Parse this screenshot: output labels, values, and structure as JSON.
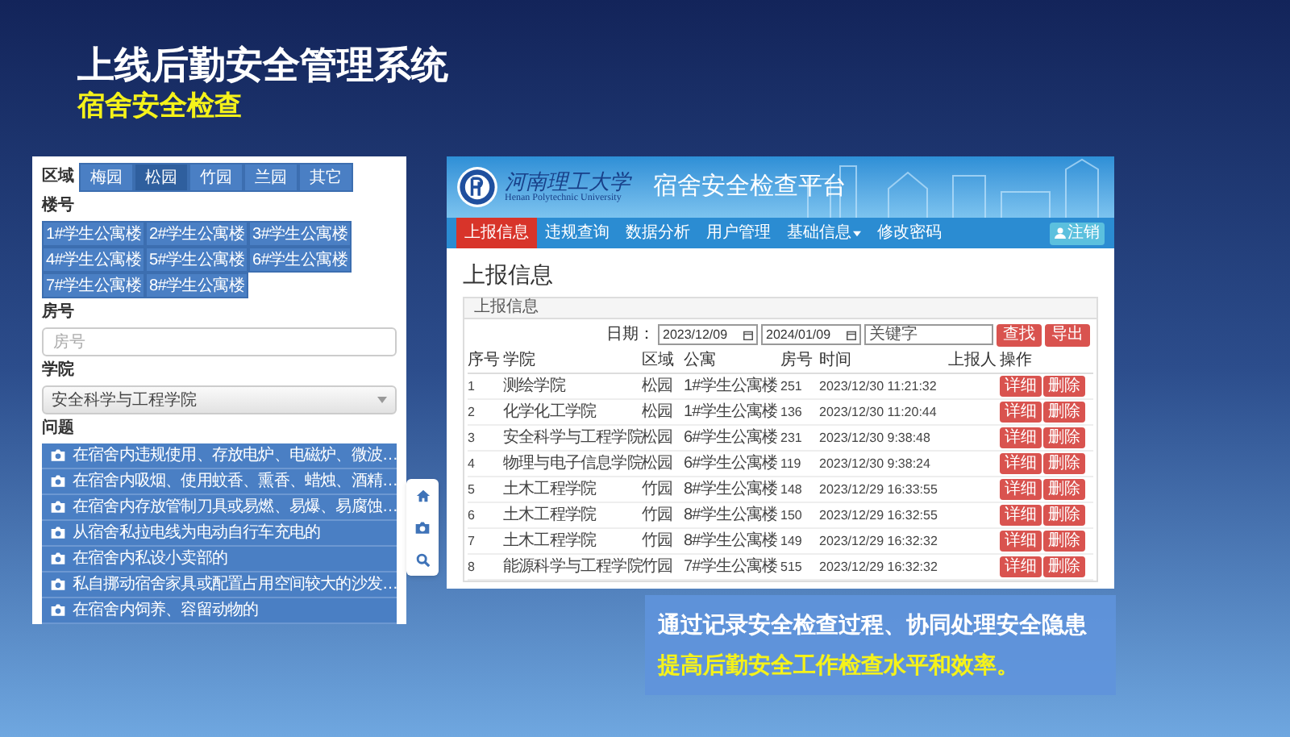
{
  "slide": {
    "title": "上线后勤安全管理系统",
    "subtitle": "宿舍安全检查"
  },
  "mobile_form": {
    "region_label": "区域",
    "regions": [
      {
        "label": "梅园",
        "selected": false
      },
      {
        "label": "松园",
        "selected": true
      },
      {
        "label": "竹园",
        "selected": false
      },
      {
        "label": "兰园",
        "selected": false
      },
      {
        "label": "其它",
        "selected": false
      }
    ],
    "building_label": "楼号",
    "buildings": [
      "1#学生公寓楼",
      "2#学生公寓楼",
      "3#学生公寓楼",
      "4#学生公寓楼",
      "5#学生公寓楼",
      "6#学生公寓楼",
      "7#学生公寓楼",
      "8#学生公寓楼"
    ],
    "room_label": "房号",
    "room_field": {
      "placeholder": "房号"
    },
    "college_label": "学院",
    "college_select": {
      "value": "安全科学与工程学院"
    },
    "problem_label": "问题",
    "problems": [
      "在宿舍内违规使用、存放电炉、电磁炉、微波…",
      "在宿舍内吸烟、使用蚊香、熏香、蜡烛、酒精…",
      "在宿舍内存放管制刀具或易燃、易爆、易腐蚀…",
      "从宿舍私拉电线为电动自行车充电的",
      "在宿舍内私设小卖部的",
      "私自挪动宿舍家具或配置占用空间较大的沙发…",
      "在宿舍内饲养、容留动物的"
    ]
  },
  "web_app": {
    "university": {
      "name": "河南理工大学",
      "name_en": "Henan Polytechnic University"
    },
    "app_title": "宿舍安全检查平台",
    "nav": [
      {
        "label": "上报信息",
        "selected": true,
        "has_menu": false
      },
      {
        "label": "违规查询",
        "selected": false,
        "has_menu": false
      },
      {
        "label": "数据分析",
        "selected": false,
        "has_menu": false
      },
      {
        "label": "用户管理",
        "selected": false,
        "has_menu": false
      },
      {
        "label": "基础信息",
        "selected": false,
        "has_menu": true
      },
      {
        "label": "修改密码",
        "selected": false,
        "has_menu": false
      }
    ],
    "logout": "注销",
    "page_title": "上报信息",
    "panel_title": "上报信息",
    "filter": {
      "date_label": "日期：",
      "start_date": "2023/12/09",
      "end_date": "2024/01/09",
      "keyword_placeholder": "关键字",
      "buttons": [
        "查找",
        "导出"
      ]
    },
    "table": {
      "columns": [
        "序号",
        "学院",
        "区域",
        "公寓",
        "房号",
        "时间",
        "上报人",
        "操作"
      ],
      "rows": [
        {
          "cells": [
            "1",
            "测绘学院",
            "松园",
            "1#学生公寓楼",
            "251",
            "2023/12/30 11:21:32"
          ],
          "actions": [
            "详细",
            "删除"
          ]
        },
        {
          "cells": [
            "2",
            "化学化工学院",
            "松园",
            "1#学生公寓楼",
            "136",
            "2023/12/30 11:20:44"
          ],
          "actions": [
            "详细",
            "删除"
          ]
        },
        {
          "cells": [
            "3",
            "安全科学与工程学院",
            "松园",
            "6#学生公寓楼",
            "231",
            "2023/12/30 9:38:48"
          ],
          "actions": [
            "详细",
            "删除"
          ]
        },
        {
          "cells": [
            "4",
            "物理与电子信息学院",
            "松园",
            "6#学生公寓楼",
            "119",
            "2023/12/30 9:38:24"
          ],
          "actions": [
            "详细",
            "删除"
          ]
        },
        {
          "cells": [
            "5",
            "土木工程学院",
            "竹园",
            "8#学生公寓楼",
            "148",
            "2023/12/29 16:33:55"
          ],
          "actions": [
            "详细",
            "删除"
          ]
        },
        {
          "cells": [
            "6",
            "土木工程学院",
            "竹园",
            "8#学生公寓楼",
            "150",
            "2023/12/29 16:32:55"
          ],
          "actions": [
            "详细",
            "删除"
          ]
        },
        {
          "cells": [
            "7",
            "土木工程学院",
            "竹园",
            "8#学生公寓楼",
            "149",
            "2023/12/29 16:32:32"
          ],
          "actions": [
            "详细",
            "删除"
          ]
        },
        {
          "cells": [
            "8",
            "能源科学与工程学院",
            "竹园",
            "7#学生公寓楼",
            "515",
            "2023/12/29 16:32:32"
          ],
          "actions": [
            "详细",
            "删除"
          ]
        }
      ]
    }
  },
  "callout": {
    "line_1": "通过记录安全检查过程、协同处理安全隐患",
    "line_2": "提高后勤安全工作检查水平和效率。"
  }
}
